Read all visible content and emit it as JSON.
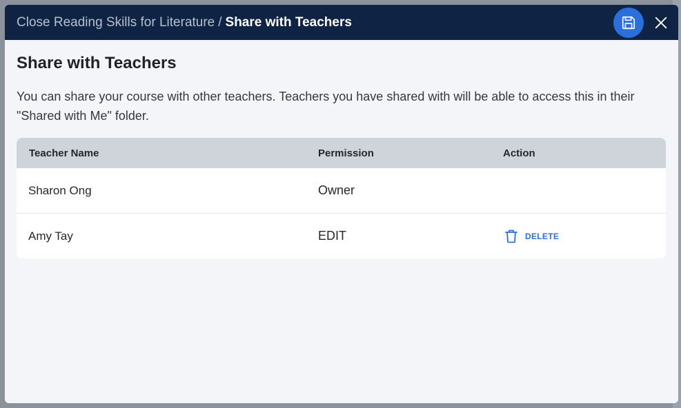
{
  "header": {
    "breadcrumb_parent": "Close Reading Skills for Literature",
    "breadcrumb_separator": "/",
    "breadcrumb_current": "Share with Teachers",
    "save_icon": "floppy-disk-icon",
    "close_icon": "close-icon"
  },
  "main": {
    "title": "Share with Teachers",
    "description": "You can share your course with other teachers. Teachers you have shared with will be able to access this in their \"Shared with Me\" folder."
  },
  "table": {
    "columns": [
      "Teacher Name",
      "Permission",
      "Action"
    ],
    "rows": [
      {
        "name": "Sharon Ong",
        "permission": "Owner",
        "action": ""
      },
      {
        "name": "Amy Tay",
        "permission": "EDIT",
        "action": "DELETE",
        "action_icon": "trash-icon"
      }
    ]
  },
  "colors": {
    "header_bg": "#0f2444",
    "accent": "#2b6fdc",
    "modal_bg": "#f3f5f9",
    "table_head_bg": "#cfd3da"
  }
}
